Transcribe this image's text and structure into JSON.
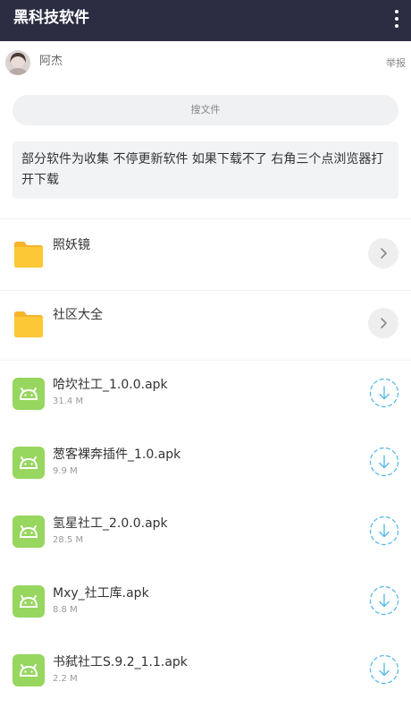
{
  "header": {
    "title": "黑科技软件",
    "menu_icon": "more-vertical-icon"
  },
  "user": {
    "name": "阿杰",
    "report_label": "举报",
    "avatar_icon": "avatar-photo"
  },
  "search": {
    "label": "搜文件"
  },
  "notice": {
    "text": "部分软件为收集 不停更新软件 如果下载不了 右角三个点浏览器打开下载"
  },
  "folders": [
    {
      "name": "照妖镜",
      "icon": "folder-icon",
      "action_icon": "chevron-right-icon"
    },
    {
      "name": "社区大全",
      "icon": "folder-icon",
      "action_icon": "chevron-right-icon"
    }
  ],
  "files": [
    {
      "name": "哈坎社工_1.0.0.apk",
      "size": "31.4 M",
      "icon": "android-apk-icon",
      "action_icon": "download-icon"
    },
    {
      "name": "葱客裸奔插件_1.0.apk",
      "size": "9.9 M",
      "icon": "android-apk-icon",
      "action_icon": "download-icon"
    },
    {
      "name": "氢星社工_2.0.0.apk",
      "size": "28.5 M",
      "icon": "android-apk-icon",
      "action_icon": "download-icon"
    },
    {
      "name": "Mxy_社工库.apk",
      "size": "8.8 M",
      "icon": "android-apk-icon",
      "action_icon": "download-icon"
    },
    {
      "name": "书弑社工S.9.2_1.1.apk",
      "size": "2.2 M",
      "icon": "android-apk-icon",
      "action_icon": "download-icon"
    }
  ],
  "colors": {
    "header_bg": "#2b2d42",
    "folder": "#fdc836",
    "apk": "#97d65f",
    "download": "#4fb6e8"
  }
}
